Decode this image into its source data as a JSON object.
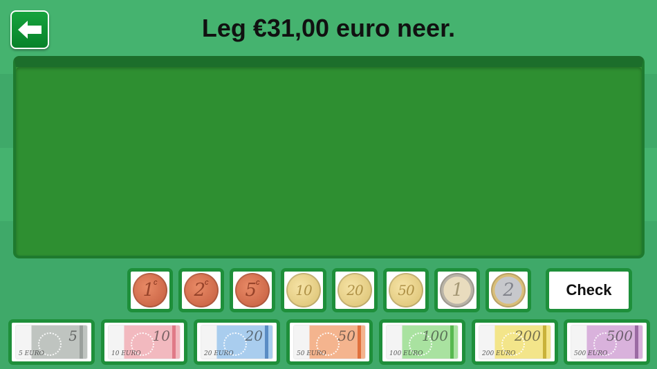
{
  "header": {
    "back_icon": "arrow-left-icon",
    "instruction": "Leg €31,00 euro neer."
  },
  "check_label": "Check",
  "coins": [
    {
      "label": "1",
      "sup": "c",
      "type": "copper"
    },
    {
      "label": "2",
      "sup": "c",
      "type": "copper"
    },
    {
      "label": "5",
      "sup": "c",
      "type": "copper"
    },
    {
      "label": "10",
      "sup": "",
      "type": "gold"
    },
    {
      "label": "20",
      "sup": "",
      "type": "gold"
    },
    {
      "label": "50",
      "sup": "",
      "type": "gold"
    },
    {
      "label": "1",
      "sup": "",
      "type": "one"
    },
    {
      "label": "2",
      "sup": "",
      "type": "two"
    }
  ],
  "notes": [
    {
      "big": "5",
      "small": "5 EURO",
      "color": "#bfc4c0",
      "stripe": "#9aa09c"
    },
    {
      "big": "10",
      "small": "10 EURO",
      "color": "#f2b9bf",
      "stripe": "#e07a87"
    },
    {
      "big": "20",
      "small": "20 EURO",
      "color": "#a9cdee",
      "stripe": "#5a8cc4"
    },
    {
      "big": "50",
      "small": "50 EURO",
      "color": "#f4b48e",
      "stripe": "#e0703d"
    },
    {
      "big": "100",
      "small": "100 EURO",
      "color": "#a9e2a0",
      "stripe": "#57b84f"
    },
    {
      "big": "200",
      "small": "200 EURO",
      "color": "#f3e58a",
      "stripe": "#c9b23a"
    },
    {
      "big": "500",
      "small": "500 EURO",
      "color": "#d9b2dc",
      "stripe": "#9b6aa3"
    }
  ],
  "colors": {
    "background": "#45b36f",
    "tray": "#2e8f31",
    "slot_border": "#1e8f3a",
    "back_button": "#0f9436"
  }
}
